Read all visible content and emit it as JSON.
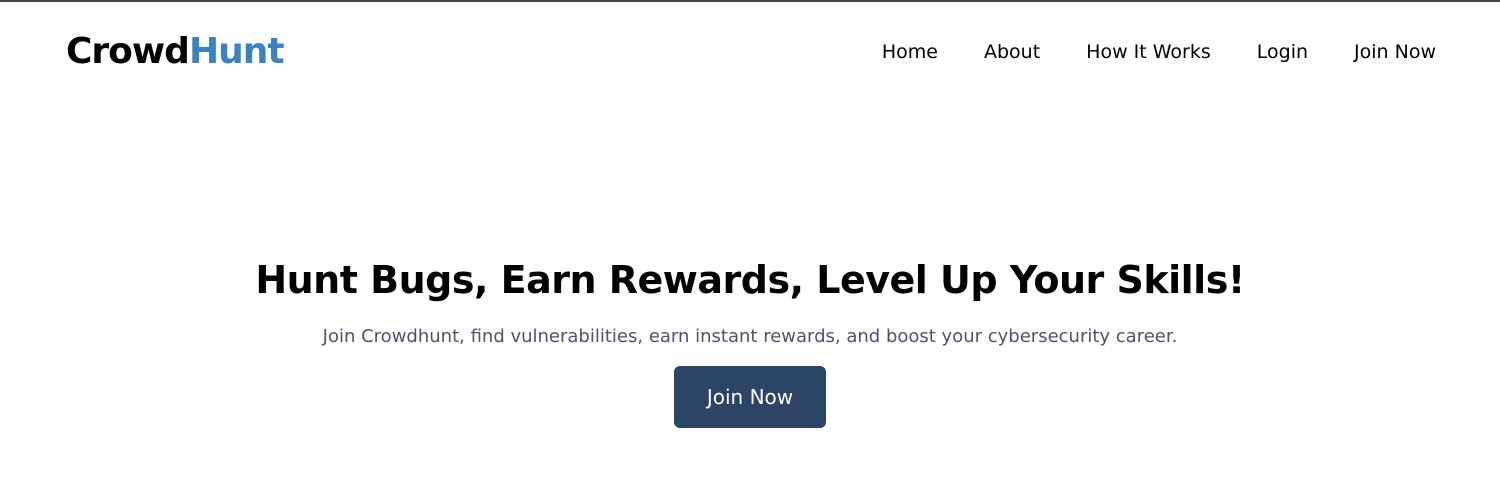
{
  "brand": {
    "name_part1": "Crowd",
    "name_part2": "Hunt",
    "accent_color": "#3b82c4"
  },
  "nav": {
    "items": [
      {
        "label": "Home"
      },
      {
        "label": "About"
      },
      {
        "label": "How It Works"
      },
      {
        "label": "Login"
      },
      {
        "label": "Join Now"
      }
    ]
  },
  "hero": {
    "title": "Hunt Bugs, Earn Rewards, Level Up Your Skills!",
    "subtitle": "Join Crowdhunt, find vulnerabilities, earn instant rewards, and boost your cybersecurity career.",
    "cta_label": "Join Now",
    "cta_color": "#2c4466"
  }
}
